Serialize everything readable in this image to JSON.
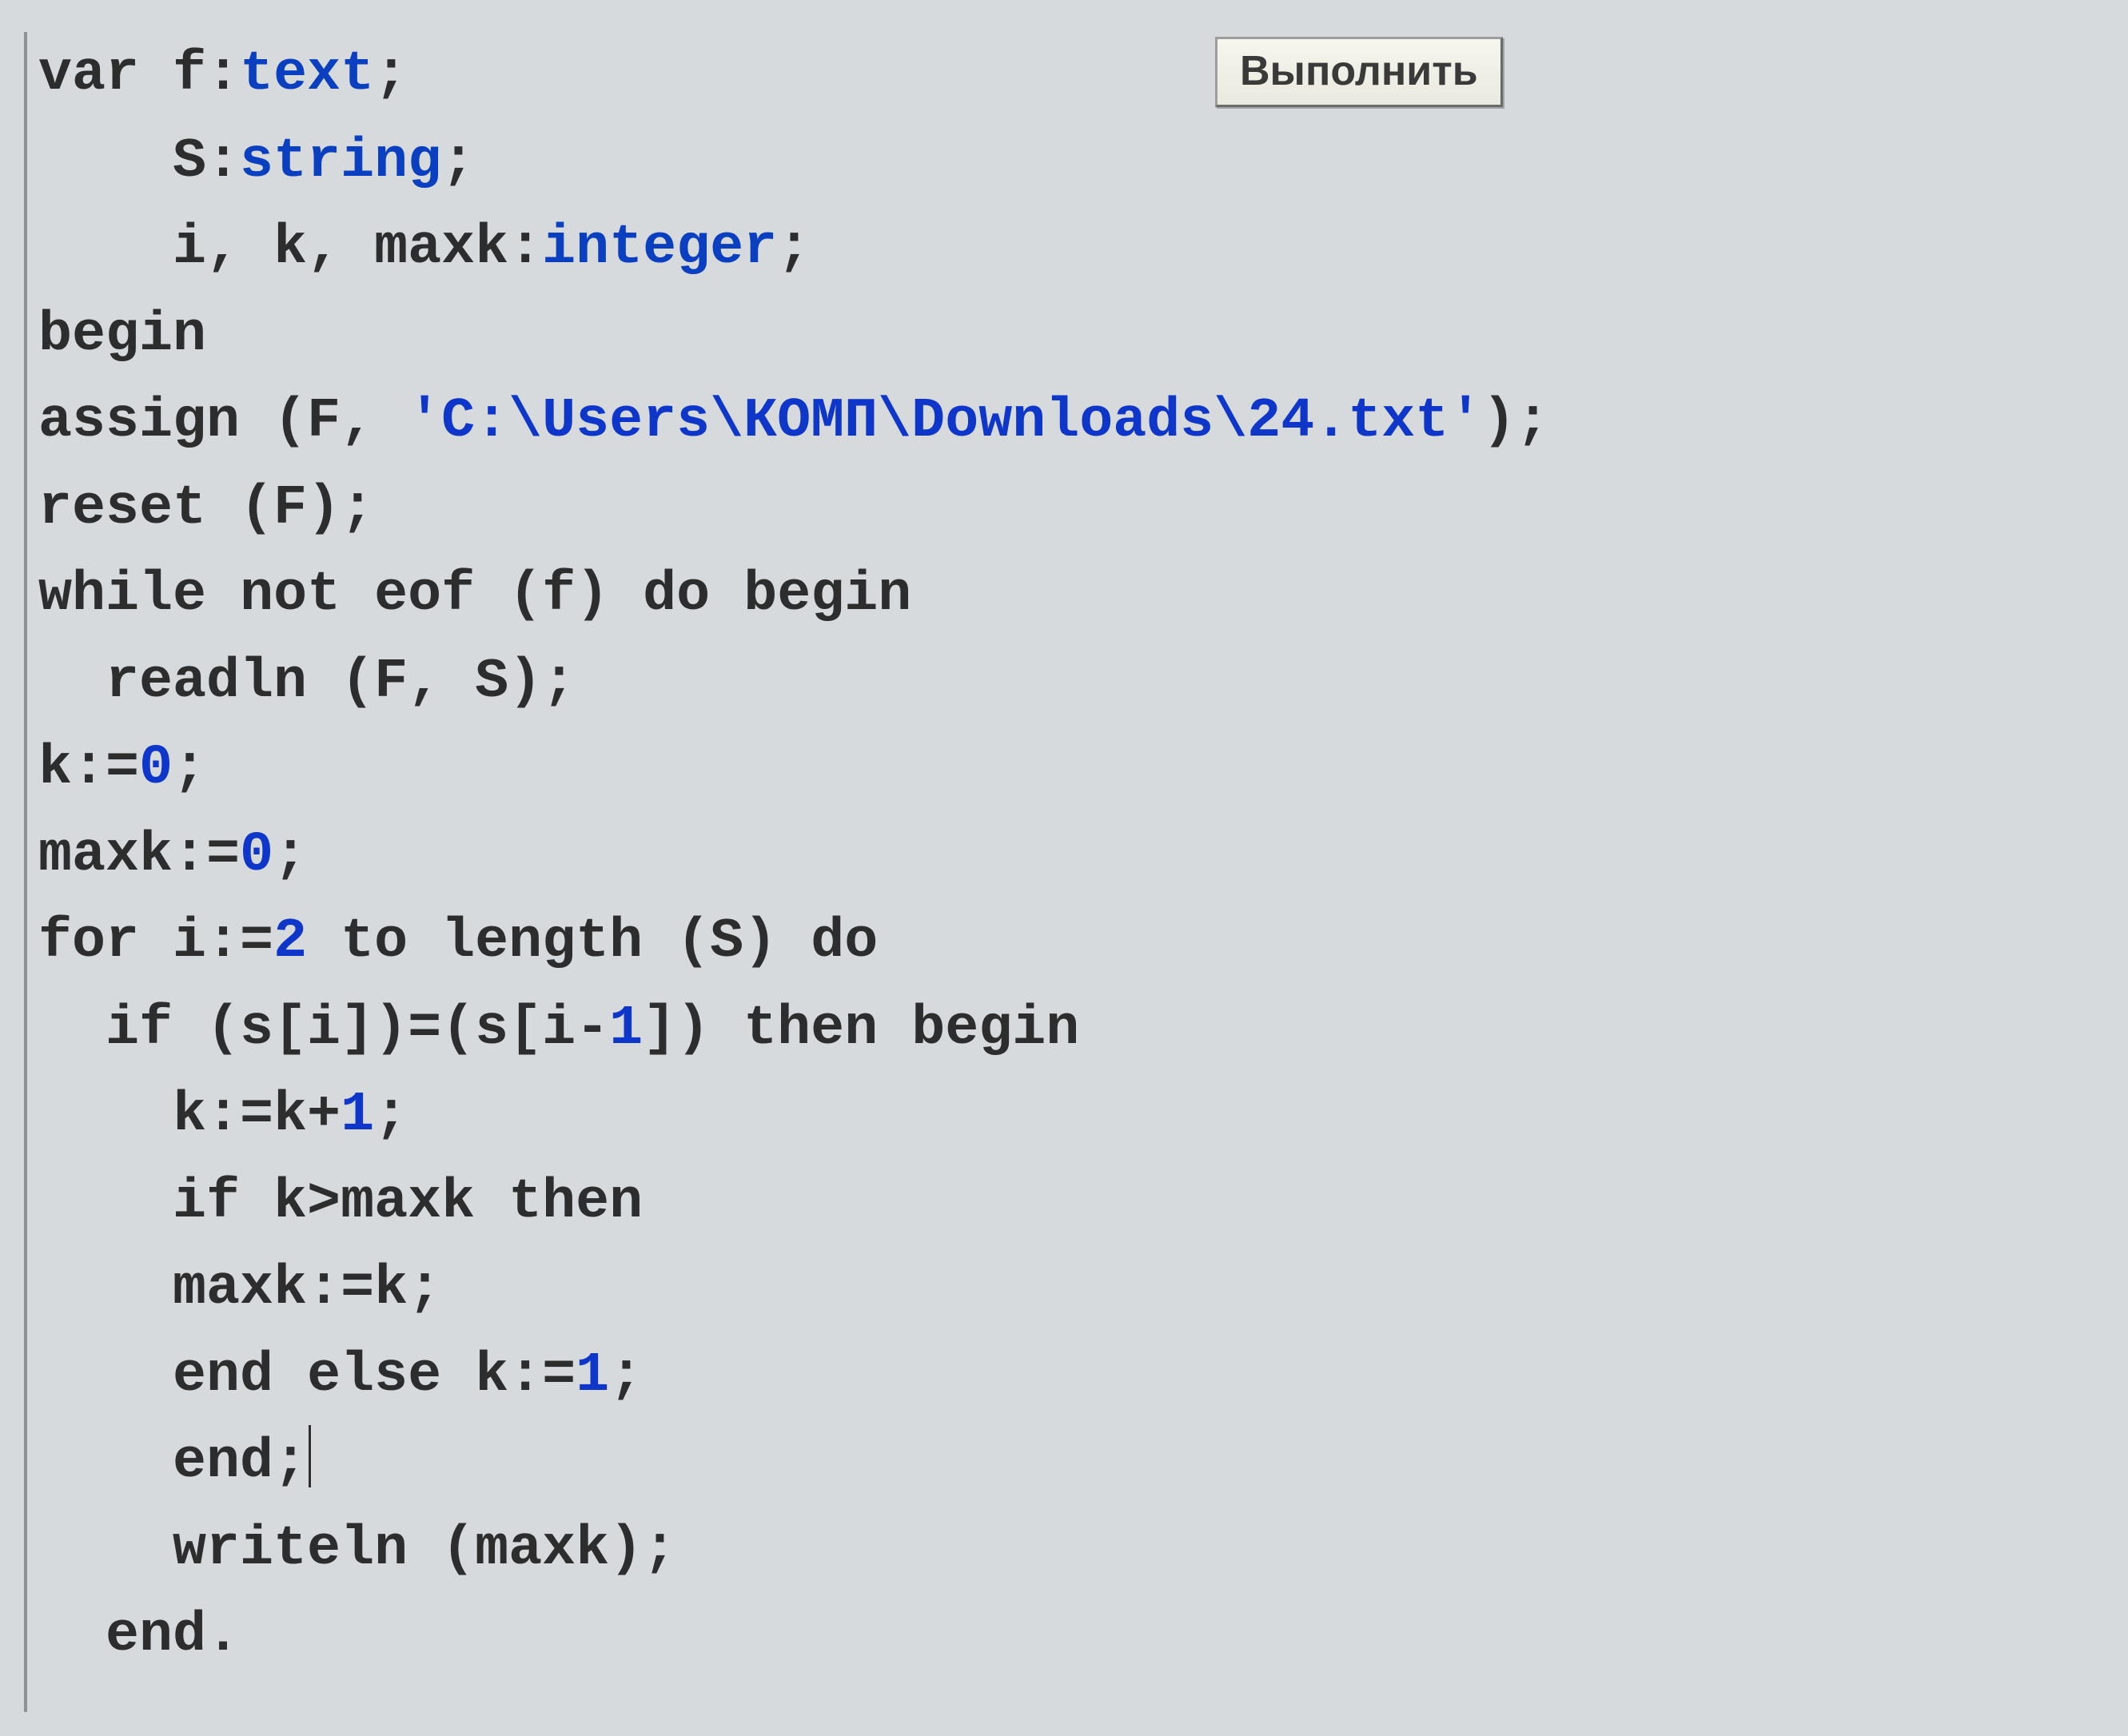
{
  "tooltip": {
    "label": "Выполнить"
  },
  "code": {
    "lines": [
      {
        "indent": 0,
        "tokens": [
          [
            "kw",
            "var"
          ],
          [
            "id",
            " f:"
          ],
          [
            "type",
            "text"
          ],
          [
            "op",
            ";"
          ]
        ]
      },
      {
        "indent": 4,
        "tokens": [
          [
            "id",
            "S:"
          ],
          [
            "type",
            "string"
          ],
          [
            "op",
            ";"
          ]
        ]
      },
      {
        "indent": 4,
        "tokens": [
          [
            "id",
            "i, k, maxk:"
          ],
          [
            "type",
            "integer"
          ],
          [
            "op",
            ";"
          ]
        ]
      },
      {
        "indent": 0,
        "tokens": [
          [
            "kw",
            "begin"
          ]
        ]
      },
      {
        "indent": 0,
        "tokens": [
          [
            "id",
            "assign (F, "
          ],
          [
            "str",
            "'C:\\Users\\КОМП\\Downloads\\24.txt'"
          ],
          [
            "op",
            ");"
          ]
        ]
      },
      {
        "indent": 0,
        "tokens": [
          [
            "id",
            "reset (F);"
          ]
        ]
      },
      {
        "indent": 0,
        "tokens": [
          [
            "kw",
            "while"
          ],
          [
            "id",
            " "
          ],
          [
            "kw",
            "not"
          ],
          [
            "id",
            " eof (f) "
          ],
          [
            "kw",
            "do"
          ],
          [
            "id",
            " "
          ],
          [
            "kw",
            "begin"
          ]
        ]
      },
      {
        "indent": 2,
        "tokens": [
          [
            "id",
            "readln (F, S);"
          ]
        ]
      },
      {
        "indent": 0,
        "tokens": [
          [
            "id",
            "k:="
          ],
          [
            "num",
            "0"
          ],
          [
            "op",
            ";"
          ]
        ]
      },
      {
        "indent": 0,
        "tokens": [
          [
            "id",
            "maxk:="
          ],
          [
            "num",
            "0"
          ],
          [
            "op",
            ";"
          ]
        ]
      },
      {
        "indent": 0,
        "tokens": [
          [
            "kw",
            "for"
          ],
          [
            "id",
            " i:="
          ],
          [
            "num",
            "2"
          ],
          [
            "id",
            " "
          ],
          [
            "kw",
            "to"
          ],
          [
            "id",
            " length (S) "
          ],
          [
            "kw",
            "do"
          ]
        ]
      },
      {
        "indent": 2,
        "tokens": [
          [
            "kw",
            "if"
          ],
          [
            "id",
            " (s[i])=(s[i-"
          ],
          [
            "num",
            "1"
          ],
          [
            "id",
            "]) "
          ],
          [
            "kw",
            "then"
          ],
          [
            "id",
            " "
          ],
          [
            "kw",
            "begin"
          ]
        ]
      },
      {
        "indent": 4,
        "tokens": [
          [
            "id",
            "k:=k+"
          ],
          [
            "num",
            "1"
          ],
          [
            "op",
            ";"
          ]
        ]
      },
      {
        "indent": 4,
        "tokens": [
          [
            "kw",
            "if"
          ],
          [
            "id",
            " k>maxk "
          ],
          [
            "kw",
            "then"
          ]
        ]
      },
      {
        "indent": 4,
        "tokens": [
          [
            "id",
            "maxk:=k;"
          ]
        ]
      },
      {
        "indent": 4,
        "tokens": [
          [
            "kw",
            "end"
          ],
          [
            "id",
            " "
          ],
          [
            "kw",
            "else"
          ],
          [
            "id",
            " k:="
          ],
          [
            "num",
            "1"
          ],
          [
            "op",
            ";"
          ]
        ]
      },
      {
        "indent": 4,
        "tokens": [
          [
            "kw",
            "end"
          ],
          [
            "op",
            ";"
          ]
        ],
        "caret": true
      },
      {
        "indent": 4,
        "tokens": [
          [
            "id",
            "writeln (maxk);"
          ]
        ]
      },
      {
        "indent": 2,
        "tokens": [
          [
            "kw",
            "end"
          ],
          [
            "op",
            "."
          ]
        ]
      }
    ]
  }
}
